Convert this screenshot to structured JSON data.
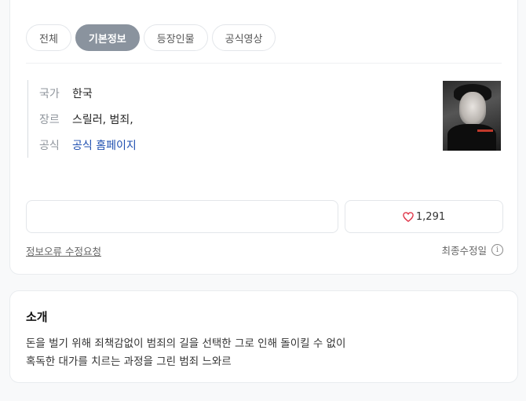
{
  "tabs": [
    {
      "label": "전체",
      "active": false
    },
    {
      "label": "기본정보",
      "active": true
    },
    {
      "label": "등장인물",
      "active": false
    },
    {
      "label": "공식영상",
      "active": false
    }
  ],
  "info": {
    "country": {
      "label": "국가",
      "value": "한국"
    },
    "genre": {
      "label": "장르",
      "value": "스릴러, 범죄,"
    },
    "official": {
      "label": "공식",
      "value": "공식 홈페이지"
    }
  },
  "poster": {
    "icon": "movie-poster-image"
  },
  "like": {
    "icon": "heart-icon",
    "count": "1,291",
    "color": "#e0384b"
  },
  "report_link": "정보오류 수정요청",
  "last_modified": {
    "label": "최종수정일",
    "icon": "info-icon",
    "glyph": "i"
  },
  "intro": {
    "title": "소개",
    "line1": "돈을 벌기 위해 죄책감없이 범죄의 길을 선택한  그로 인해 돌이킬 수 없이",
    "line2": "혹독한 대가를 치르는 과정을 그린 범죄 느와르"
  },
  "colors": {
    "accent_link": "#1f4fb0",
    "active_tab": "#8a939e"
  }
}
